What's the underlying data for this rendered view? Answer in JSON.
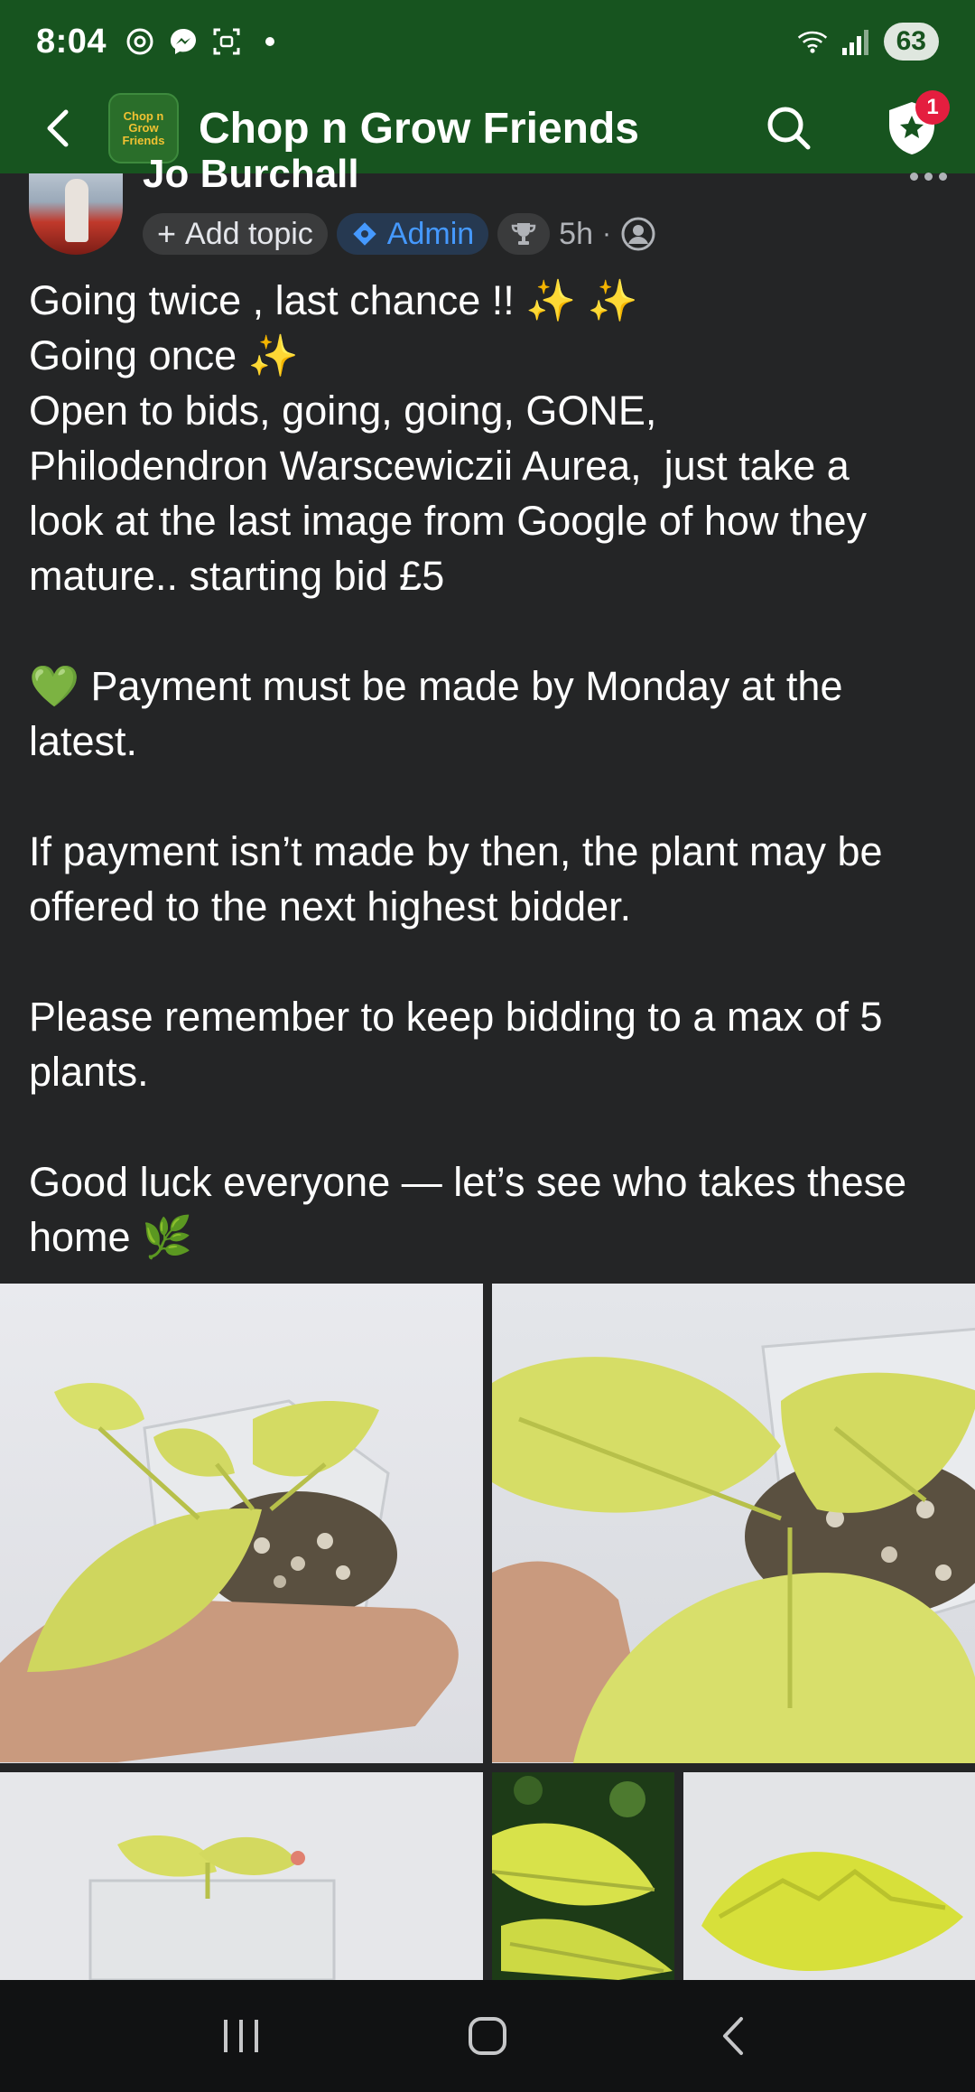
{
  "status_bar": {
    "time": "8:04",
    "battery": "63"
  },
  "app_bar": {
    "title": "Chop n Grow Friends",
    "logo_text": [
      "Chop n Grow",
      "Friends"
    ],
    "notification_count": "1",
    "colors": {
      "background": "#17541f"
    }
  },
  "post": {
    "author": "Jo Burchall",
    "add_topic_label": "Add topic",
    "admin_label": "Admin",
    "time": "5h",
    "separator": "·",
    "body": [
      "Going twice , last chance !! ✨ ✨",
      "Going once ✨",
      "Open to bids, going, going, GONE,",
      "Philodendron Warscewiczii Aurea,  just take a",
      "look at the last image from Google of how they",
      "mature.. starting bid £5",
      "",
      "💚 Payment must be made by Monday at the",
      "latest.",
      "",
      "If payment isn’t made by then, the plant may be",
      "offered to the next highest bidder.",
      "",
      "Please remember to keep bidding to a max of 5",
      "plants.",
      "",
      "Good luck everyone — let’s see who takes these",
      "home 🌿"
    ],
    "photos": [
      {
        "subject": "hand holding yellow philodendron in pot"
      },
      {
        "subject": "close-up of yellow leaves"
      },
      {
        "subject": "plant in clear pot"
      },
      {
        "subject": "mature yellow leaves outdoors"
      },
      {
        "subject": "yellow leaf on white background"
      }
    ]
  },
  "icons": {
    "back": "back-arrow-icon",
    "search": "search-icon",
    "shield": "shield-star-icon",
    "more": "more-dots-icon",
    "trophy": "trophy-icon",
    "privacy": "group-members-icon",
    "nav_recents": "recents-icon",
    "nav_home": "home-icon",
    "nav_back": "nav-back-icon"
  }
}
